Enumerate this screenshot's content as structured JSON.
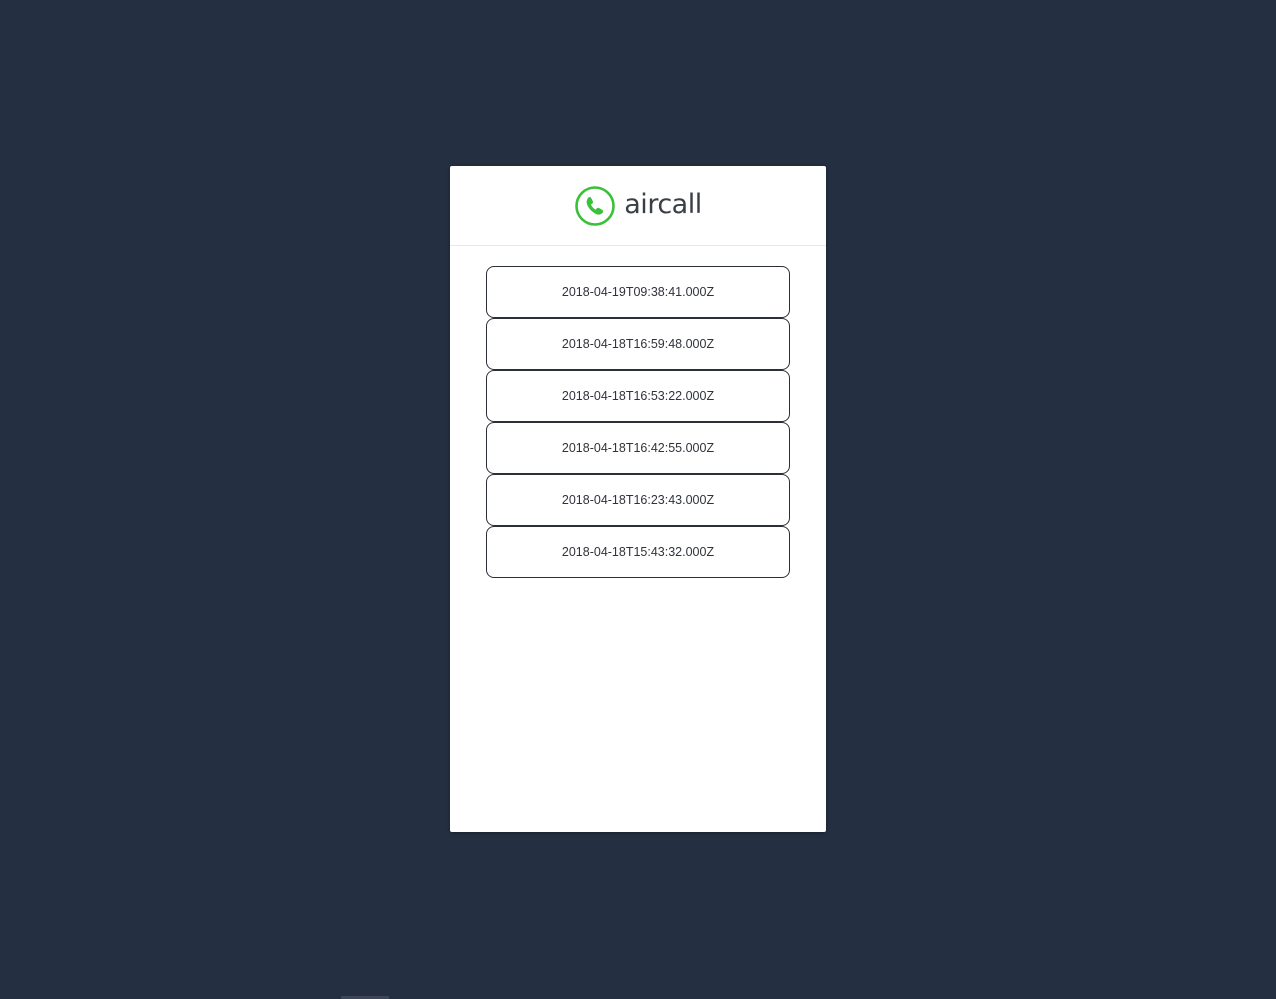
{
  "brand": {
    "name": "aircall",
    "icon": "phone-icon",
    "accent_color": "#3ac03a"
  },
  "calls": [
    {
      "timestamp": "2018-04-19T09:38:41.000Z"
    },
    {
      "timestamp": "2018-04-18T16:59:48.000Z"
    },
    {
      "timestamp": "2018-04-18T16:53:22.000Z"
    },
    {
      "timestamp": "2018-04-18T16:42:55.000Z"
    },
    {
      "timestamp": "2018-04-18T16:23:43.000Z"
    },
    {
      "timestamp": "2018-04-18T15:43:32.000Z"
    }
  ],
  "colors": {
    "background": "#243042",
    "card": "#ffffff"
  }
}
